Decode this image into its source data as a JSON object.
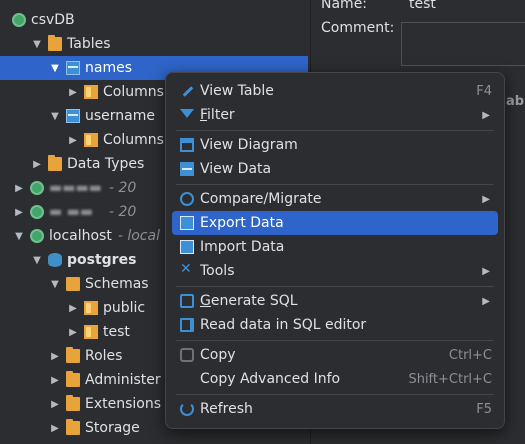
{
  "tree": {
    "csvdb": "csvDB",
    "tables": "Tables",
    "names": "names",
    "columns_names": "Columns",
    "username": "username",
    "columns_username": "Columns",
    "data_types": "Data Types",
    "blurred1": "- 20",
    "blurred2": "- 20",
    "localhost": "localhost",
    "localhost_hint": "- local",
    "postgres": "postgres",
    "schemas": "Schemas",
    "public": "public",
    "test": "test",
    "roles": "Roles",
    "administer": "Administer",
    "extensions": "Extensions",
    "storage": "Storage"
  },
  "right_panel": {
    "name_label": "Name:",
    "name_value": "test",
    "comment_label": "Comment:",
    "faded_text": "able"
  },
  "menu": {
    "view_table": "View Table",
    "view_table_sc": "F4",
    "filter_first": "F",
    "filter_rest": "ilter",
    "view_diagram": "View Diagram",
    "view_data": "View Data",
    "compare_migrate": "Compare/Migrate",
    "export_data": "Export Data",
    "import_data": "Import Data",
    "tools": "Tools",
    "gen_sql_first": "G",
    "gen_sql_rest": "enerate SQL",
    "read_sql": "Read data in SQL editor",
    "copy": "Copy",
    "copy_sc": "Ctrl+C",
    "copy_adv": "Copy Advanced Info",
    "copy_adv_sc": "Shift+Ctrl+C",
    "refresh": "Refresh",
    "refresh_sc": "F5"
  }
}
